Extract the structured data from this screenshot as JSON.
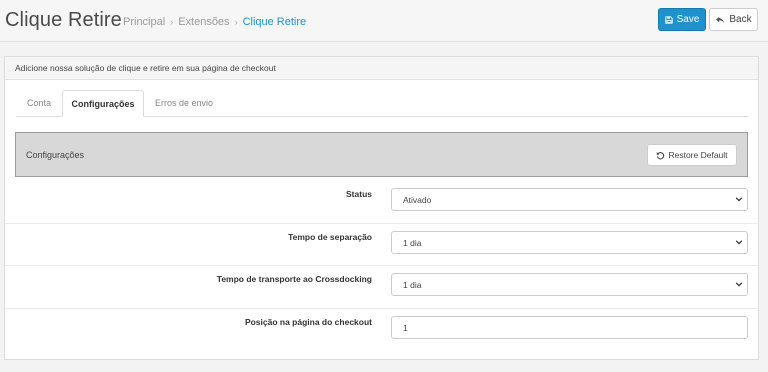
{
  "header": {
    "title": "Clique Retire",
    "breadcrumb": [
      "Principal",
      "Extensões",
      "Clique Retire"
    ],
    "save_label": "Save",
    "back_label": "Back"
  },
  "panel": {
    "heading": "Adicione nossa solução de clique e retire em sua página de checkout",
    "tabs": [
      {
        "label": "Conta",
        "active": false
      },
      {
        "label": "Configurações",
        "active": true
      },
      {
        "label": "Erros de envio",
        "active": false
      }
    ],
    "config": {
      "label": "Configurações",
      "restore_label": "Restore Default"
    },
    "fields": [
      {
        "label": "Status",
        "value": "Ativado",
        "type": "select"
      },
      {
        "label": "Tempo de separação",
        "value": "1 dia",
        "type": "select"
      },
      {
        "label": "Tempo de transporte ao Crossdocking",
        "value": "1 dia",
        "type": "select"
      },
      {
        "label": "Posição na página do checkout",
        "value": "1",
        "type": "input"
      }
    ]
  },
  "colors": {
    "accent": "#1e91cf",
    "config_bg": "#d8d8d8"
  }
}
